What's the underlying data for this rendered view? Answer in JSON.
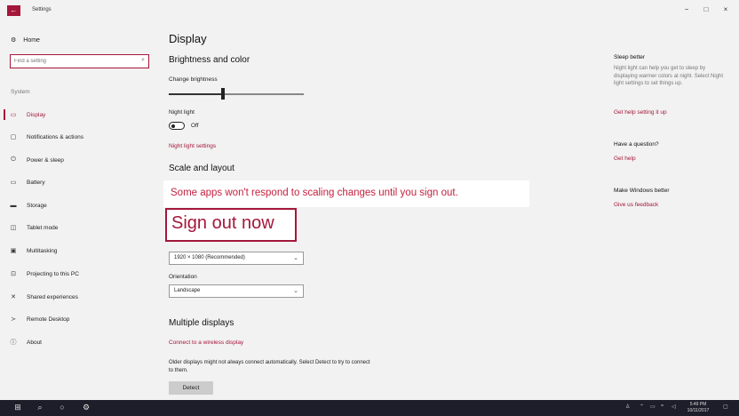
{
  "window": {
    "title": "Settings",
    "back_icon": "arrow-left-icon",
    "minimize": "−",
    "maximize": "□",
    "close": "×"
  },
  "sidebar": {
    "home_label": "Home",
    "search_placeholder": "Find a setting",
    "section_label": "System",
    "items": [
      {
        "label": "Display",
        "icon": "monitor-icon",
        "active": true
      },
      {
        "label": "Notifications & actions",
        "icon": "notification-icon"
      },
      {
        "label": "Power & sleep",
        "icon": "power-icon"
      },
      {
        "label": "Battery",
        "icon": "battery-icon"
      },
      {
        "label": "Storage",
        "icon": "storage-icon"
      },
      {
        "label": "Tablet mode",
        "icon": "tablet-icon"
      },
      {
        "label": "Multitasking",
        "icon": "multitasking-icon"
      },
      {
        "label": "Projecting to this PC",
        "icon": "projector-icon"
      },
      {
        "label": "Shared experiences",
        "icon": "shared-icon"
      },
      {
        "label": "Remote Desktop",
        "icon": "remote-desktop-icon"
      },
      {
        "label": "About",
        "icon": "info-icon"
      }
    ]
  },
  "main": {
    "title": "Display",
    "brightness_heading": "Brightness and color",
    "brightness_label": "Change brightness",
    "brightness_level": 0.4,
    "night_light_label": "Night light",
    "night_light_state": "Off",
    "night_light_settings_link": "Night light settings",
    "scale_heading": "Scale and layout",
    "resolution_value": "1920 × 1080 (Recommended)",
    "orientation_label": "Orientation",
    "orientation_value": "Landscape",
    "multiple_heading": "Multiple displays",
    "wireless_link": "Connect to a wireless display",
    "older_displays_text": "Older displays might not always connect automatically. Select Detect to try to connect to them.",
    "detect_button": "Detect"
  },
  "callout": {
    "message": "Some apps won't respond to scaling changes until you sign out.",
    "sign_out": "Sign out now"
  },
  "right_panel": {
    "sleep_title": "Sleep better",
    "sleep_body": "Night light can help you get to sleep by displaying warmer colors at night. Select Night light settings to set things up.",
    "sleep_link": "Get help setting it up",
    "question_title": "Have a question?",
    "question_link": "Get help",
    "better_title": "Make Windows better",
    "better_link": "Give us feedback"
  },
  "taskbar": {
    "time": "5:49 PM",
    "date": "10/11/2017"
  },
  "colors": {
    "accent": "#a4173a",
    "taskbar": "#1e1e2a"
  }
}
